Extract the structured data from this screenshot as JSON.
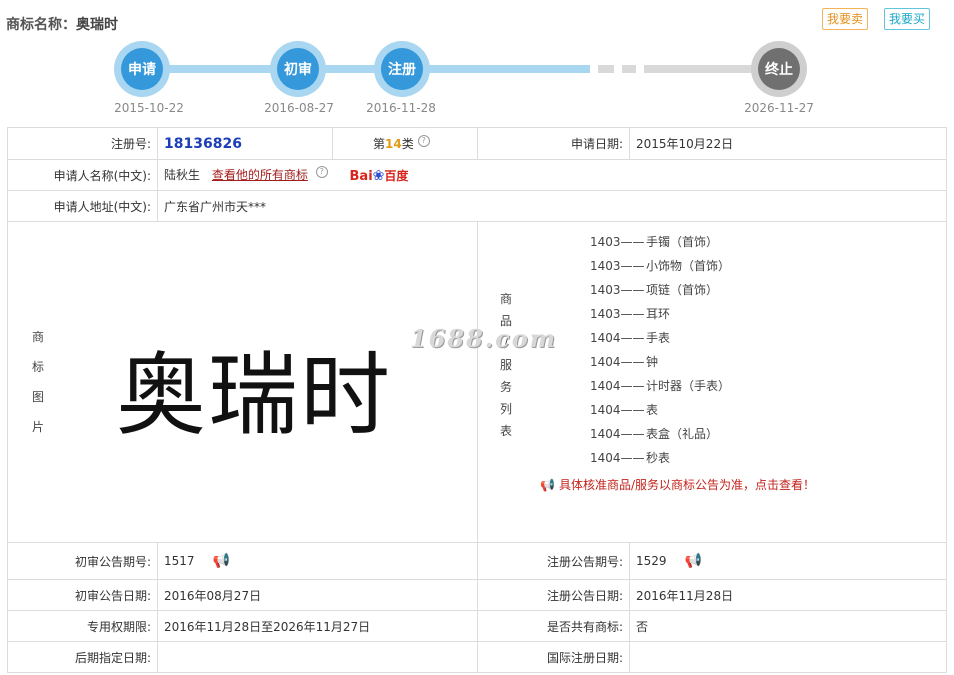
{
  "header": {
    "title_label": "商标名称：",
    "title_value": "奥瑞时",
    "sell_button": "我要卖",
    "buy_button": "我要买"
  },
  "timeline": {
    "steps": [
      {
        "label": "申请",
        "date": "2015-10-22"
      },
      {
        "label": "初审",
        "date": "2016-08-27"
      },
      {
        "label": "注册",
        "date": "2016-11-28"
      },
      {
        "label": "终止",
        "date": "2026-11-27"
      }
    ]
  },
  "info": {
    "reg_no_label": "注册号:",
    "reg_no": "18136826",
    "class_prefix": "第",
    "class_num": "14",
    "class_suffix": "类",
    "apply_date_label": "申请日期:",
    "apply_date": "2015年10月22日",
    "applicant_label": "申请人名称(中文):",
    "applicant": "陆秋生",
    "all_marks_link": "查看他的所有商标",
    "baidu_bai": "Bai",
    "baidu_du": "百度",
    "address_label": "申请人地址(中文):",
    "address": "广东省广州市天***",
    "image_label": [
      "商",
      "标",
      "图",
      "片"
    ],
    "mark_text": "奥瑞时",
    "goods_label": [
      "商",
      "品",
      "/",
      "服",
      "务",
      "列",
      "表"
    ],
    "goods": [
      {
        "code": "1403——",
        "name": "手镯（首饰）"
      },
      {
        "code": "1403——",
        "name": "小饰物（首饰）"
      },
      {
        "code": "1403——",
        "name": "项链（首饰）"
      },
      {
        "code": "1403——",
        "name": "耳环"
      },
      {
        "code": "1404——",
        "name": "手表"
      },
      {
        "code": "1404——",
        "name": "钟"
      },
      {
        "code": "1404——",
        "name": "计时器（手表）"
      },
      {
        "code": "1404——",
        "name": "表"
      },
      {
        "code": "1404——",
        "name": "表盒（礼品）"
      },
      {
        "code": "1404——",
        "name": "秒表"
      }
    ],
    "goods_notice": "具体核准商品/服务以商标公告为准，点击查看！",
    "watermark": "1688.com",
    "prelim_no_label": "初审公告期号:",
    "prelim_no": "1517",
    "reg_pub_no_label": "注册公告期号:",
    "reg_pub_no": "1529",
    "prelim_date_label": "初审公告日期:",
    "prelim_date": "2016年08月27日",
    "reg_pub_date_label": "注册公告日期:",
    "reg_pub_date": "2016年11月28日",
    "exclusive_label": "专用权期限:",
    "exclusive": "2016年11月28日至2026年11月27日",
    "shared_label": "是否共有商标:",
    "shared": "否",
    "later_label": "后期指定日期:",
    "later": "",
    "intl_label": "国际注册日期:",
    "intl": ""
  },
  "colors": {
    "accent_blue": "#3598db",
    "timeline_done": "#a9d6f1",
    "timeline_future": "#d9d9d9",
    "terminated": "#707070",
    "link_red": "#a31c1c"
  }
}
